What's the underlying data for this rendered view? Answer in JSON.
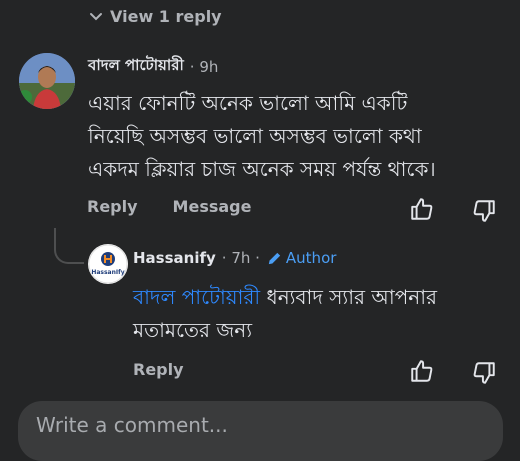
{
  "view_reply": {
    "label": "View 1 reply",
    "icon": "chevron-down-icon"
  },
  "comment": {
    "author": "বাদল পাটোয়ারী",
    "time": "· 9h",
    "lines": [
      "এয়ার ফোনটি অনেক ভালো আমি একটি",
      "নিয়েছি অসম্ভব ভালো অসম্ভব ভালো কথা",
      "একদম ক্লিয়ার চাজ অনেক সময় পর্যন্ত থাকে।"
    ],
    "reply_label": "Reply",
    "message_label": "Message"
  },
  "reply": {
    "author": "Hassanify",
    "time": "· 7h ·",
    "badge": "Author",
    "avatar_text": "HassanIfy",
    "mention": "বাদল পাটোয়ারী",
    "line1_rest": " ধন্যবাদ স্যার আপনার",
    "line2": "মতামতের জন্য",
    "reply_label": "Reply"
  },
  "composer": {
    "placeholder": "Write a comment..."
  },
  "colors": {
    "background": "#242526",
    "link": "#2e89ff",
    "author_badge": "#4b9ef4",
    "muted": "#b0b3b8"
  }
}
